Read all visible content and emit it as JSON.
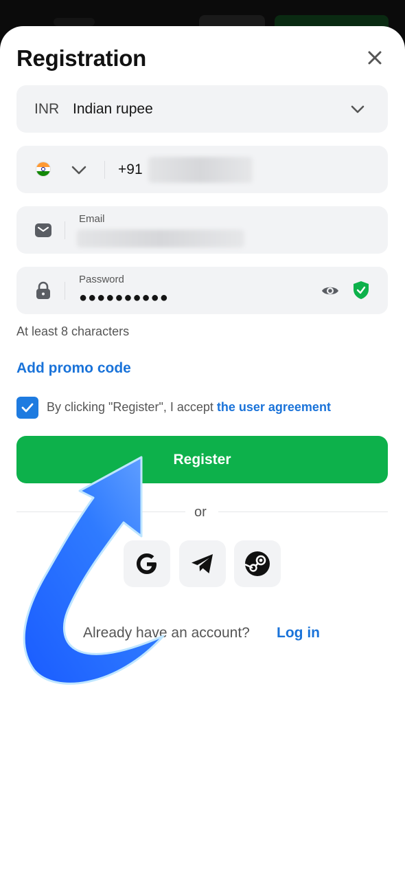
{
  "dialog": {
    "title": "Registration",
    "close_icon": "close-icon"
  },
  "currency": {
    "code": "INR",
    "name": "Indian rupee",
    "icon": "chevron-down-icon"
  },
  "phone": {
    "flag_icon": "india-flag-icon",
    "country_code": "+91"
  },
  "email": {
    "label": "Email",
    "icon": "mail-icon"
  },
  "password": {
    "label": "Password",
    "value_masked": "●●●●●●●●●●",
    "icons": [
      "lock-icon",
      "eye-icon",
      "shield-check-icon"
    ],
    "hint": "At least 8 characters"
  },
  "promo": {
    "label": "Add promo code"
  },
  "agreement": {
    "checked": true,
    "text": "By clicking \"Register\", I accept ",
    "link": "the user agreement"
  },
  "register_label": "Register",
  "divider_text": "or",
  "social": [
    "google-icon",
    "telegram-icon",
    "steam-icon"
  ],
  "footer": {
    "question": "Already have an account?",
    "login_link": "Log in"
  },
  "colors": {
    "primary_green": "#0db14b",
    "link_blue": "#1a73d9",
    "field_bg": "#f2f3f5",
    "shield_green": "#0db14b",
    "arrow_blue": "#2f7bff"
  }
}
